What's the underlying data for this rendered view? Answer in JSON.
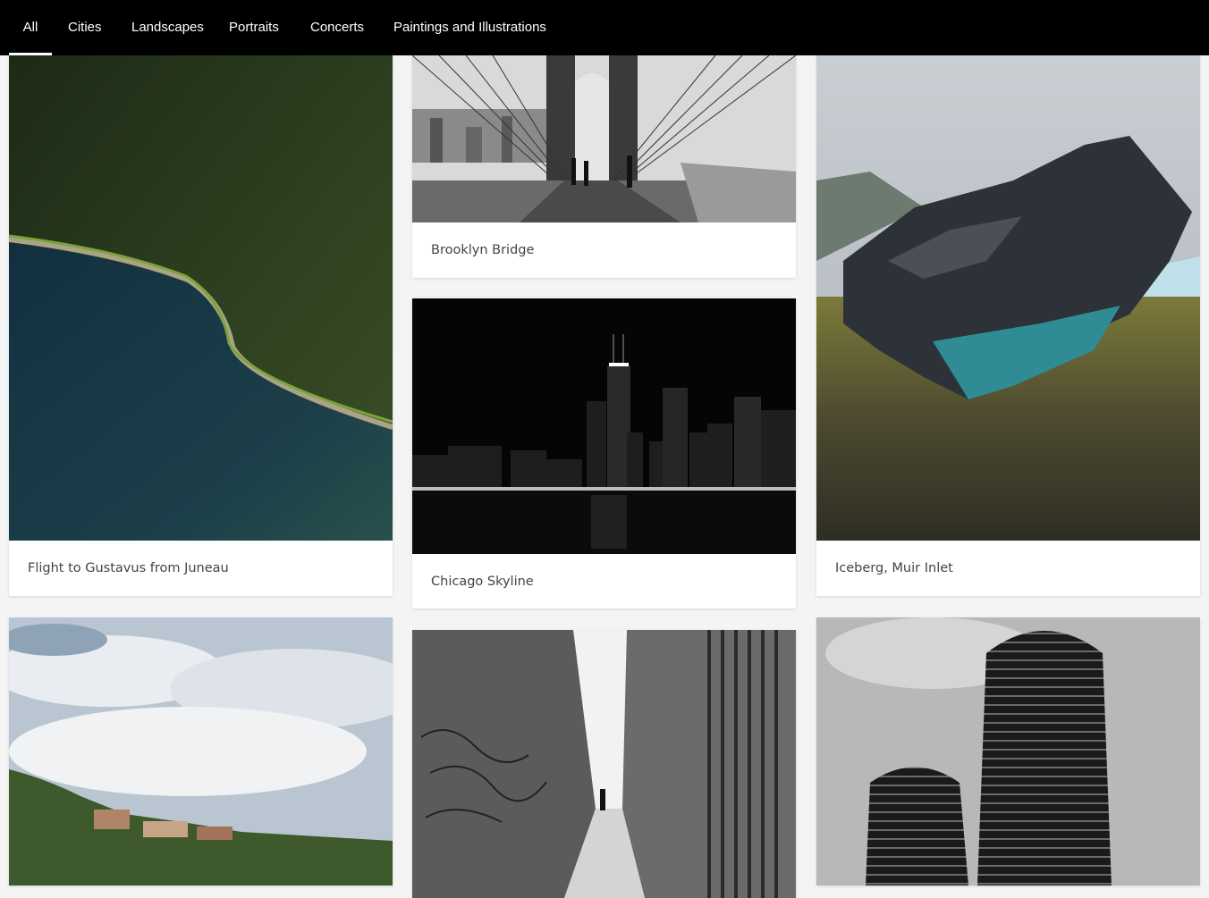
{
  "nav": {
    "tabs": [
      {
        "label": "All",
        "active": true
      },
      {
        "label": "Cities",
        "active": false
      },
      {
        "label": "Landscapes",
        "active": false
      },
      {
        "label": "Portraits",
        "active": false
      },
      {
        "label": "Concerts",
        "active": false
      },
      {
        "label": "Paintings and Illustrations",
        "active": false
      }
    ]
  },
  "gallery": {
    "cards": [
      {
        "caption": "Flight to Gustavus from Juneau",
        "subject": "aerial-forest-lake"
      },
      {
        "caption": "Brooklyn Bridge",
        "subject": "suspension-bridge-walkway"
      },
      {
        "caption": "Iceberg, Muir Inlet",
        "subject": "iceberg-on-shore"
      },
      {
        "caption": "Chicago Skyline",
        "subject": "city-skyline-night"
      },
      {
        "caption": "",
        "subject": "cloudy-sky-hillside-houses"
      },
      {
        "caption": "",
        "subject": "graffiti-alley"
      },
      {
        "caption": "",
        "subject": "round-tower-building"
      }
    ]
  },
  "colors": {
    "nav_bg": "#000000",
    "nav_text": "#ffffff",
    "page_bg": "#f4f4f4",
    "card_bg": "#ffffff",
    "caption_text": "#444444"
  }
}
